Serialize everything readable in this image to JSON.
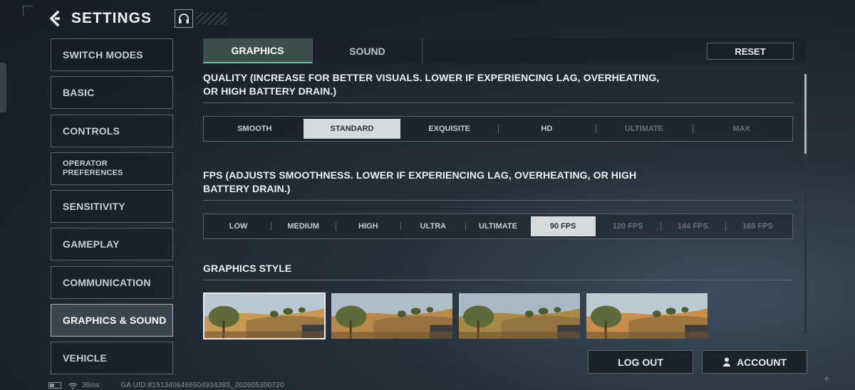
{
  "header": {
    "title": "SETTINGS",
    "back_icon": "back-arrow-icon",
    "headset_icon": "headset-icon"
  },
  "sidebar": {
    "items": [
      {
        "label": "SWITCH MODES"
      },
      {
        "label": "BASIC"
      },
      {
        "label": "CONTROLS"
      },
      {
        "label": "OPERATOR\nPREFERENCES"
      },
      {
        "label": "SENSITIVITY"
      },
      {
        "label": "GAMEPLAY"
      },
      {
        "label": "COMMUNICATION"
      },
      {
        "label": "GRAPHICS & SOUND"
      },
      {
        "label": "VEHICLE"
      }
    ],
    "active_index": 7
  },
  "tabs": {
    "items": [
      {
        "label": "GRAPHICS"
      },
      {
        "label": "SOUND"
      }
    ],
    "active_index": 0
  },
  "reset": {
    "label": "RESET"
  },
  "quality": {
    "title": "QUALITY (INCREASE FOR BETTER VISUALS. LOWER IF EXPERIENCING LAG, OVERHEATING, OR HIGH BATTERY DRAIN.)",
    "options": [
      "SMOOTH",
      "STANDARD",
      "EXQUISITE",
      "HD",
      "ULTIMATE",
      "MAX"
    ],
    "selected": "STANDARD",
    "disabled": [
      "ULTIMATE",
      "MAX"
    ]
  },
  "fps": {
    "title": "FPS (ADJUSTS SMOOTHNESS. LOWER IF EXPERIENCING LAG, OVERHEATING, OR HIGH BATTERY DRAIN.)",
    "options": [
      "LOW",
      "MEDIUM",
      "HIGH",
      "ULTRA",
      "ULTIMATE",
      "90 FPS",
      "120 FPS",
      "144 FPS",
      "165 FPS"
    ],
    "selected": "90 FPS",
    "disabled": [
      "120 FPS",
      "144 FPS",
      "165 FPS"
    ]
  },
  "graphics_style": {
    "title": "GRAPHICS STYLE",
    "thumbnails": [
      {
        "tint": "#c79a54",
        "sky": "#b9c8d2"
      },
      {
        "tint": "#b88a4a",
        "sky": "#aebfca"
      },
      {
        "tint": "#a98a45",
        "sky": "#a9bac4"
      },
      {
        "tint": "#c98f4a",
        "sky": "#bccad2"
      }
    ],
    "selected_index": 0
  },
  "bottom": {
    "logout_label": "LOG OUT",
    "account_label": "ACCOUNT",
    "account_icon": "user-icon"
  },
  "status": {
    "ping": "36ms",
    "uid": "GA UID:8151340646650493438S_202605300720"
  },
  "colors": {
    "accent": "#4ec9a6",
    "active_tab_bg": "#3a4e4a",
    "selected_option_bg": "#d7dadd"
  }
}
